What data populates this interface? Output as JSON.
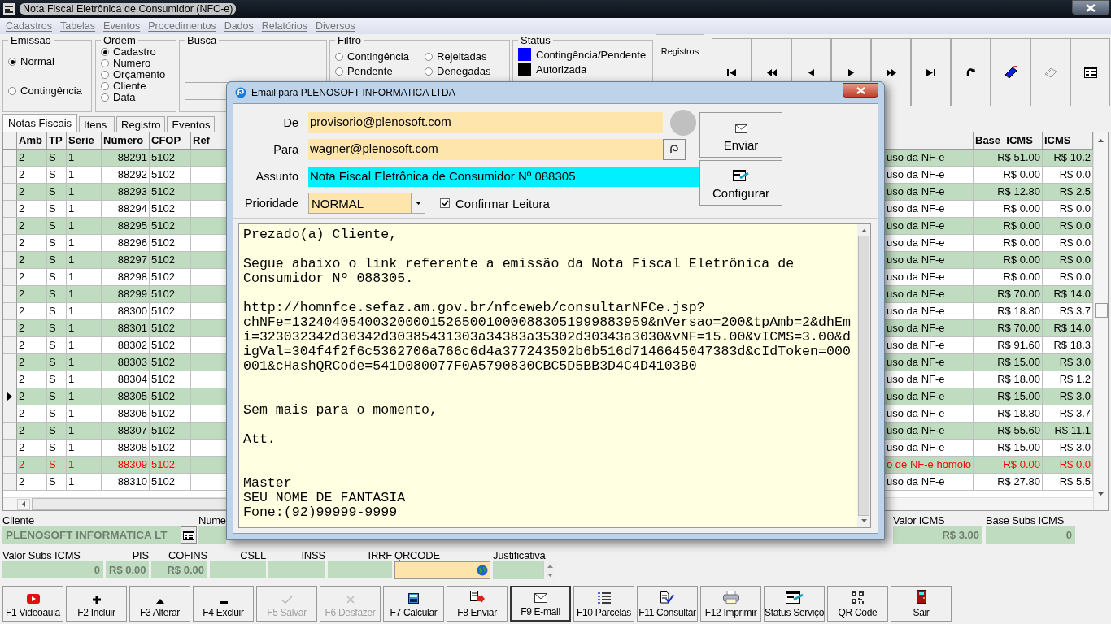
{
  "window": {
    "title": "Nota Fiscal Eletrônica de Consumidor (NFC-e)"
  },
  "menu": [
    "Cadastros",
    "Tabelas",
    "Eventos",
    "Procedimentos",
    "Dados",
    "Relatórios",
    "Diversos"
  ],
  "emissao": {
    "label": "Emissão",
    "options": [
      {
        "label": "Normal",
        "selected": true
      },
      {
        "label": "Contingência",
        "selected": false
      }
    ]
  },
  "ordem": {
    "label": "Ordem",
    "options": [
      {
        "label": "Cadastro",
        "selected": true
      },
      {
        "label": "Numero",
        "selected": false
      },
      {
        "label": "Orçamento",
        "selected": false
      },
      {
        "label": "Cliente",
        "selected": false
      },
      {
        "label": "Data",
        "selected": false
      }
    ]
  },
  "busca": {
    "label": "Busca"
  },
  "filtro": {
    "label": "Filtro",
    "options": [
      {
        "label": "Contingência",
        "selected": false
      },
      {
        "label": "Rejeitadas",
        "selected": false
      },
      {
        "label": "Pendente",
        "selected": false
      },
      {
        "label": "Denegadas",
        "selected": false
      }
    ]
  },
  "status": {
    "label": "Status",
    "items": [
      {
        "label": "Contingência/Pendente",
        "color": "#0000ff"
      },
      {
        "label": "Autorizada",
        "color": "#000000"
      }
    ]
  },
  "registros": {
    "label": "Registros"
  },
  "nav_buttons": [
    {
      "kind": "first"
    },
    {
      "kind": "rewind"
    },
    {
      "kind": "prev"
    },
    {
      "kind": "next"
    },
    {
      "kind": "forward"
    },
    {
      "kind": "last"
    },
    {
      "kind": "refresh"
    },
    {
      "kind": "tag"
    },
    {
      "kind": "goto"
    },
    {
      "kind": "form"
    }
  ],
  "tabs": [
    {
      "label": "Notas Fiscais",
      "selected": true
    },
    {
      "label": "Itens",
      "selected": false
    },
    {
      "label": "Registro",
      "selected": false
    },
    {
      "label": "Eventos",
      "selected": false
    }
  ],
  "table": {
    "columns": [
      "Amb",
      "TP",
      "Serie",
      "Número",
      "CFOP",
      "Ref"
    ],
    "right_columns": [
      "Base_ICMS",
      "ICMS"
    ],
    "rows": [
      {
        "amb": "2",
        "tp": "S",
        "serie": "1",
        "numero": "88291",
        "cfop": "5102",
        "column_8": "uso da NF-e",
        "base_icms": "R$ 51.00",
        "icms": "R$ 10.2",
        "current": false,
        "error": false
      },
      {
        "amb": "2",
        "tp": "S",
        "serie": "1",
        "numero": "88292",
        "cfop": "5102",
        "column_8": "uso da NF-e",
        "base_icms": "R$ 0.00",
        "icms": "R$ 0.0",
        "current": false,
        "error": false
      },
      {
        "amb": "2",
        "tp": "S",
        "serie": "1",
        "numero": "88293",
        "cfop": "5102",
        "column_8": "uso da NF-e",
        "base_icms": "R$ 12.80",
        "icms": "R$ 2.5",
        "current": false,
        "error": false
      },
      {
        "amb": "2",
        "tp": "S",
        "serie": "1",
        "numero": "88294",
        "cfop": "5102",
        "column_8": "uso da NF-e",
        "base_icms": "R$ 0.00",
        "icms": "R$ 0.0",
        "current": false,
        "error": false
      },
      {
        "amb": "2",
        "tp": "S",
        "serie": "1",
        "numero": "88295",
        "cfop": "5102",
        "column_8": "uso da NF-e",
        "base_icms": "R$ 0.00",
        "icms": "R$ 0.0",
        "current": false,
        "error": false
      },
      {
        "amb": "2",
        "tp": "S",
        "serie": "1",
        "numero": "88296",
        "cfop": "5102",
        "column_8": "uso da NF-e",
        "base_icms": "R$ 0.00",
        "icms": "R$ 0.0",
        "current": false,
        "error": false
      },
      {
        "amb": "2",
        "tp": "S",
        "serie": "1",
        "numero": "88297",
        "cfop": "5102",
        "column_8": "uso da NF-e",
        "base_icms": "R$ 0.00",
        "icms": "R$ 0.0",
        "current": false,
        "error": false
      },
      {
        "amb": "2",
        "tp": "S",
        "serie": "1",
        "numero": "88298",
        "cfop": "5102",
        "column_8": "uso da NF-e",
        "base_icms": "R$ 0.00",
        "icms": "R$ 0.0",
        "current": false,
        "error": false
      },
      {
        "amb": "2",
        "tp": "S",
        "serie": "1",
        "numero": "88299",
        "cfop": "5102",
        "column_8": "uso da NF-e",
        "base_icms": "R$ 70.00",
        "icms": "R$ 14.0",
        "current": false,
        "error": false
      },
      {
        "amb": "2",
        "tp": "S",
        "serie": "1",
        "numero": "88300",
        "cfop": "5102",
        "column_8": "uso da NF-e",
        "base_icms": "R$ 18.80",
        "icms": "R$ 3.7",
        "current": false,
        "error": false
      },
      {
        "amb": "2",
        "tp": "S",
        "serie": "1",
        "numero": "88301",
        "cfop": "5102",
        "column_8": "uso da NF-e",
        "base_icms": "R$ 70.00",
        "icms": "R$ 14.0",
        "current": false,
        "error": false
      },
      {
        "amb": "2",
        "tp": "S",
        "serie": "1",
        "numero": "88302",
        "cfop": "5102",
        "column_8": "uso da NF-e",
        "base_icms": "R$ 91.60",
        "icms": "R$ 18.3",
        "current": false,
        "error": false
      },
      {
        "amb": "2",
        "tp": "S",
        "serie": "1",
        "numero": "88303",
        "cfop": "5102",
        "column_8": "uso da NF-e",
        "base_icms": "R$ 15.00",
        "icms": "R$ 3.0",
        "current": false,
        "error": false
      },
      {
        "amb": "2",
        "tp": "S",
        "serie": "1",
        "numero": "88304",
        "cfop": "5102",
        "column_8": "uso da NF-e",
        "base_icms": "R$ 18.00",
        "icms": "R$ 1.2",
        "current": false,
        "error": false
      },
      {
        "amb": "2",
        "tp": "S",
        "serie": "1",
        "numero": "88305",
        "cfop": "5102",
        "column_8": "uso da NF-e",
        "base_icms": "R$ 15.00",
        "icms": "R$ 3.0",
        "current": true,
        "error": false
      },
      {
        "amb": "2",
        "tp": "S",
        "serie": "1",
        "numero": "88306",
        "cfop": "5102",
        "column_8": "uso da NF-e",
        "base_icms": "R$ 18.80",
        "icms": "R$ 3.7",
        "current": false,
        "error": false
      },
      {
        "amb": "2",
        "tp": "S",
        "serie": "1",
        "numero": "88307",
        "cfop": "5102",
        "column_8": "uso da NF-e",
        "base_icms": "R$ 55.60",
        "icms": "R$ 11.1",
        "current": false,
        "error": false
      },
      {
        "amb": "2",
        "tp": "S",
        "serie": "1",
        "numero": "88308",
        "cfop": "5102",
        "column_8": "uso da NF-e",
        "base_icms": "R$ 15.00",
        "icms": "R$ 3.0",
        "current": false,
        "error": false
      },
      {
        "amb": "2",
        "tp": "S",
        "serie": "1",
        "numero": "88309",
        "cfop": "5102",
        "column_8": "o de NF-e homolo",
        "base_icms": "R$ 0.00",
        "icms": "R$ 0.0",
        "current": false,
        "error": true
      },
      {
        "amb": "2",
        "tp": "S",
        "serie": "1",
        "numero": "88310",
        "cfop": "5102",
        "column_8": "uso da NF-e",
        "base_icms": "R$ 27.80",
        "icms": "R$ 5.5",
        "current": false,
        "error": false
      }
    ]
  },
  "info_row1": {
    "cliente": {
      "label": "Cliente",
      "value": "PLENOSOFT INFORMATICA LT"
    },
    "numero": {
      "label": "Nume"
    },
    "right": [
      {
        "label": "Valor ICMS",
        "value": "R$ 3.00"
      },
      {
        "label": "Base Subs ICMS",
        "value": "0"
      }
    ]
  },
  "info_row2": [
    {
      "label": "Valor Subs ICMS",
      "value": "0",
      "kind": "value"
    },
    {
      "label": "PIS",
      "value": "R$ 0.00",
      "kind": "value"
    },
    {
      "label": "COFINS",
      "value": "R$ 0.00",
      "kind": "value"
    },
    {
      "label": "CSLL",
      "kind": "value"
    },
    {
      "label": "INSS",
      "kind": "value"
    },
    {
      "label": "IRRF",
      "kind": "value"
    },
    {
      "label": "QRCODE",
      "kind": "qrcode"
    },
    {
      "label": "Justificativa",
      "kind": "spin"
    }
  ],
  "toolbar": [
    {
      "label": "F1 Videoaula",
      "kind": "video",
      "disabled": false,
      "focused": false
    },
    {
      "label": "F2 Incluir",
      "kind": "plus",
      "disabled": false,
      "focused": false
    },
    {
      "label": "F3 Alterar",
      "kind": "up",
      "disabled": false,
      "focused": false
    },
    {
      "label": "F4 Excluir",
      "kind": "minus",
      "disabled": false,
      "focused": false
    },
    {
      "label": "F5 Salvar",
      "kind": "check",
      "disabled": true,
      "focused": false
    },
    {
      "label": "F6 Desfazer",
      "kind": "cross",
      "disabled": true,
      "focused": false
    },
    {
      "label": "F7 Calcular",
      "kind": "calculator",
      "disabled": false,
      "focused": false
    },
    {
      "label": "F8 Enviar",
      "kind": "send",
      "disabled": false,
      "focused": false
    },
    {
      "label": "F9 E-mail",
      "kind": "mail",
      "disabled": false,
      "focused": true
    },
    {
      "label": "F10 Parcelas",
      "kind": "list",
      "disabled": false,
      "focused": false
    },
    {
      "label": "F11 Consultar",
      "kind": "doccheck",
      "disabled": false,
      "focused": false
    },
    {
      "label": "F12 Imprimir",
      "kind": "printer",
      "disabled": false,
      "focused": false
    },
    {
      "label": "Status Serviço",
      "kind": "card",
      "disabled": false,
      "focused": false
    },
    {
      "label": "QR Code",
      "kind": "qr",
      "disabled": false,
      "focused": false
    },
    {
      "label": "Sair",
      "kind": "door",
      "disabled": false,
      "focused": false
    }
  ],
  "dialog": {
    "title": "Email para PLENOSOFT INFORMATICA LTDA",
    "fields": [
      {
        "label": "De",
        "value": "provisorio@plenosoft.com",
        "kind": "from",
        "highlighted": false
      },
      {
        "label": "Para",
        "value": "wagner@plenosoft.com",
        "kind": "to",
        "highlighted": false
      },
      {
        "label": "Assunto",
        "value": "Nota Fiscal Eletrônica de Consumidor Nº 088305",
        "kind": "subject",
        "highlighted": true
      }
    ],
    "priority": {
      "label": "Prioridade",
      "value": "NORMAL"
    },
    "confirm": {
      "label": "Confirmar Leitura",
      "checked": true
    },
    "buttons": [
      {
        "label": "Enviar",
        "kind": "send"
      },
      {
        "label": "Configurar",
        "kind": "config"
      }
    ],
    "body": "Prezado(a) Cliente,\n\nSegue abaixo o link referente a emissão da Nota Fiscal Eletrônica de\nConsumidor Nº 088305.\n\nhttp://homnfce.sefaz.am.gov.br/nfceweb/consultarNFCe.jsp?\nchNFe=13240405400320000152650010000883051999883959&nVersao=200&tpAmb=2&dhEm\ni=323032342d30342d30385431303a34383a35302d30343a3030&vNF=15.00&vICMS=3.00&d\nigVal=304f4f2f6c5362706a766c6d4a377243502b6b516d7146645047383d&cIdToken=000\n001&cHashQRCode=541D080077F0A5790830CBC5D5BB3D4C4D4103B0\n\n\nSem mais para o momento,\n\nAtt.\n\n\nMaster\nSEU NOME DE FANTASIA\nFone:(92)99999-9999"
  }
}
